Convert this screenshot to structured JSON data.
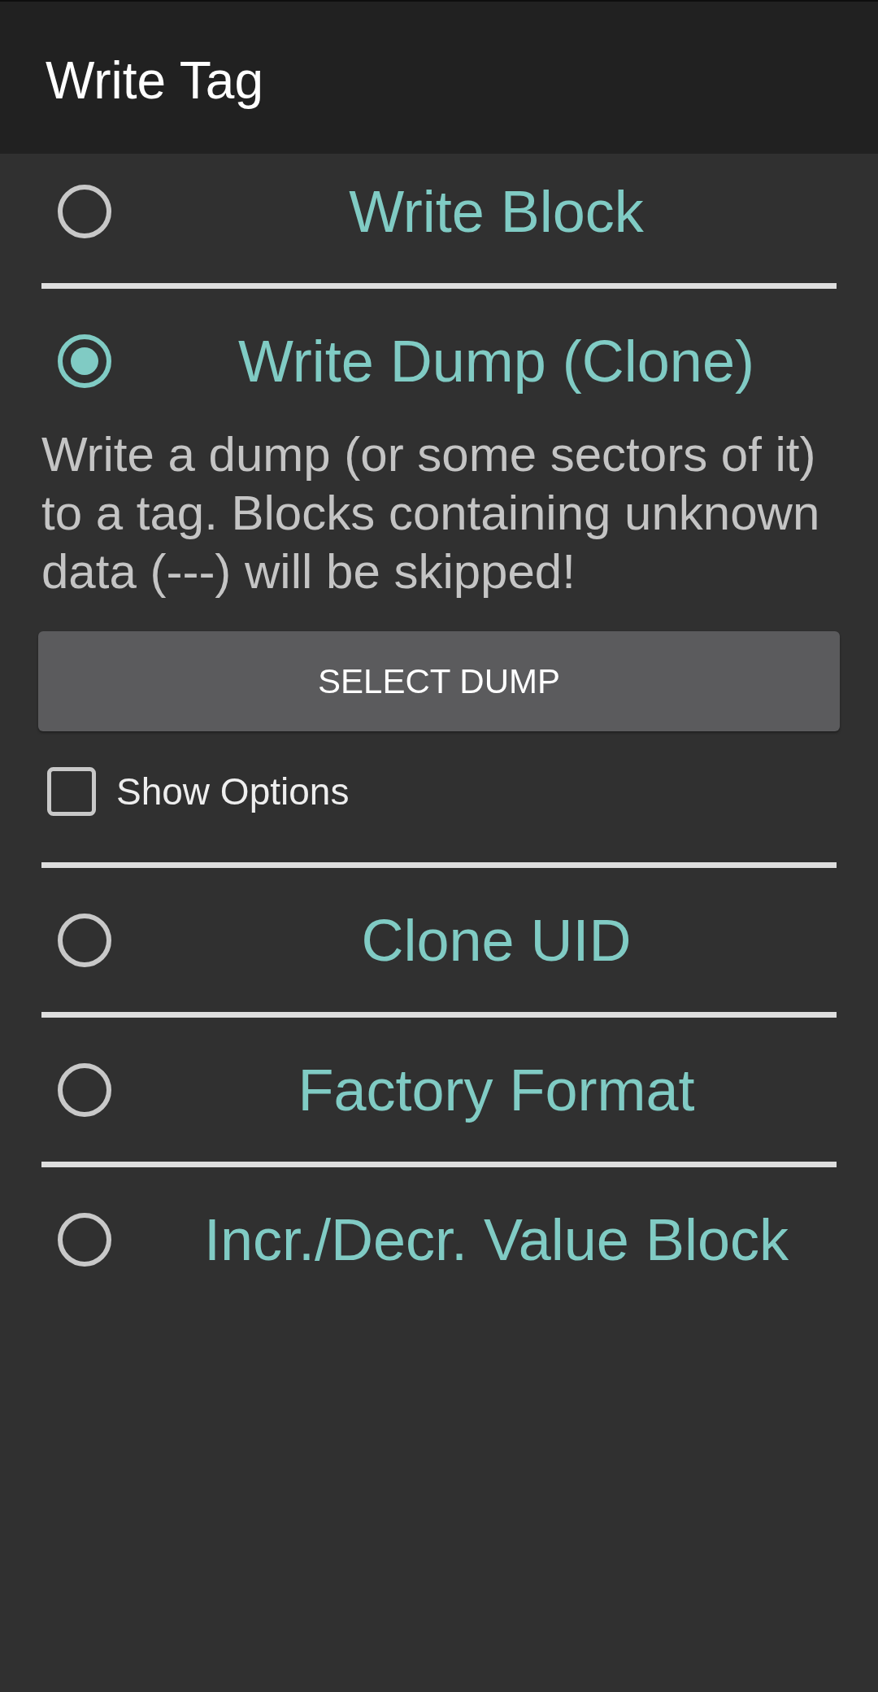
{
  "app_bar": {
    "title": "Write Tag"
  },
  "options": [
    {
      "label": "Write Block",
      "selected": false
    },
    {
      "label": "Write Dump (Clone)",
      "selected": true,
      "description": "Write a dump (or some sectors of it) to a tag. Blocks containing unknown data (---) will be skipped!",
      "button": "SELECT DUMP",
      "checkbox": {
        "label": "Show Options",
        "checked": false
      }
    },
    {
      "label": "Clone UID",
      "selected": false
    },
    {
      "label": "Factory Format",
      "selected": false
    },
    {
      "label": "Incr./Decr. Value Block",
      "selected": false
    }
  ]
}
